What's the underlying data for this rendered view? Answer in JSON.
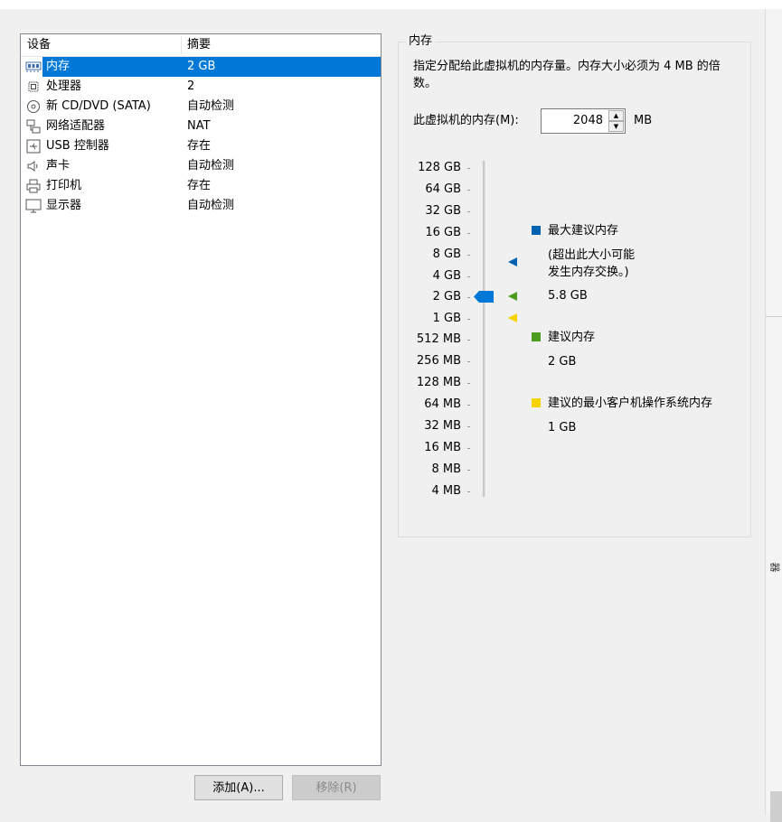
{
  "colors": {
    "selection": "#0078d7",
    "max_recommended": "#0063b1",
    "recommended": "#4b9c1f",
    "min_recommended": "#f5d300",
    "thumb": "#0078d7"
  },
  "device_list": {
    "headers": {
      "device": "设备",
      "summary": "摘要"
    },
    "rows": [
      {
        "name": "内存",
        "summary": "2 GB",
        "icon": "memory-icon",
        "selected": true
      },
      {
        "name": "处理器",
        "summary": "2",
        "icon": "processor-icon",
        "selected": false
      },
      {
        "name": "新 CD/DVD (SATA)",
        "summary": "自动检测",
        "icon": "cd-dvd-icon",
        "selected": false
      },
      {
        "name": "网络适配器",
        "summary": "NAT",
        "icon": "network-adapter-icon",
        "selected": false
      },
      {
        "name": "USB 控制器",
        "summary": "存在",
        "icon": "usb-icon",
        "selected": false
      },
      {
        "name": "声卡",
        "summary": "自动检测",
        "icon": "speaker-icon",
        "selected": false
      },
      {
        "name": "打印机",
        "summary": "存在",
        "icon": "printer-icon",
        "selected": false
      },
      {
        "name": "显示器",
        "summary": "自动检测",
        "icon": "monitor-icon",
        "selected": false
      }
    ]
  },
  "buttons": {
    "add": "添加(A)...",
    "remove": "移除(R)"
  },
  "memory": {
    "group_title": "内存",
    "description": "指定分配给此虚拟机的内存量。内存大小必须为 4 MB 的倍数。",
    "field_label": "此虚拟机的内存(M):",
    "value": "2048",
    "unit": "MB",
    "scale_labels": [
      "128 GB",
      "64 GB",
      "32 GB",
      "16 GB",
      "8 GB",
      "4 GB",
      "2 GB",
      "1 GB",
      "512 MB",
      "256 MB",
      "128 MB",
      "64 MB",
      "32 MB",
      "16 MB",
      "8 MB",
      "4 MB"
    ],
    "current_level_index": 6,
    "marker_levels": {
      "max_recommended": 5.26,
      "recommended": 6,
      "min_recommended": 7
    },
    "legend": {
      "max_title": "最大建议内存",
      "max_note_line1": "(超出此大小可能",
      "max_note_line2": "发生内存交换。)",
      "max_value": "5.8 GB",
      "rec_title": "建议内存",
      "rec_value": "2 GB",
      "min_title": "建议的最小客户机操作系统内存",
      "min_value": "1 GB"
    }
  },
  "side_strip": {
    "glyph": "器"
  }
}
